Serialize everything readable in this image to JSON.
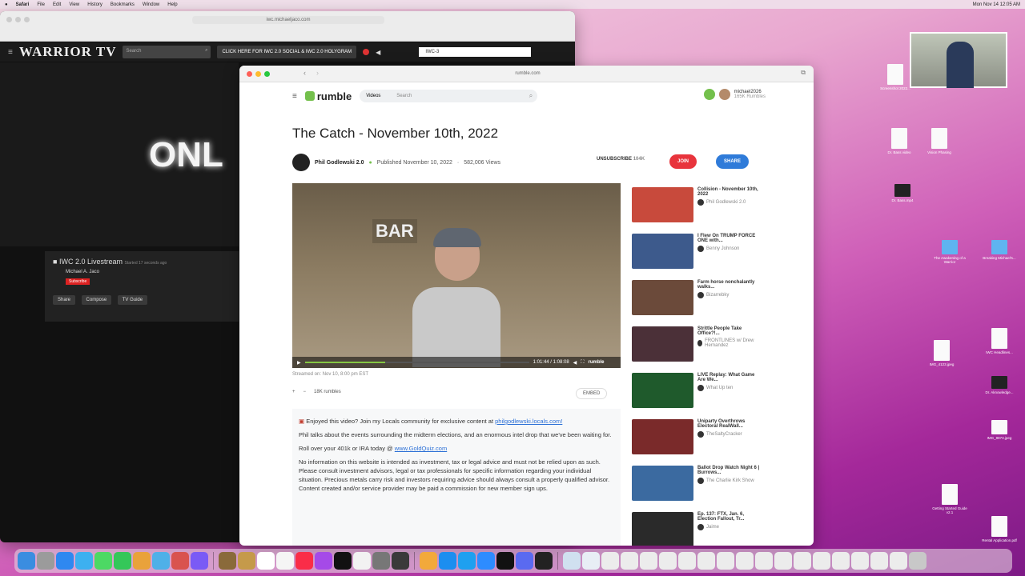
{
  "menubar": {
    "app": "Safari",
    "items": [
      "File",
      "Edit",
      "View",
      "History",
      "Bookmarks",
      "Window",
      "Help"
    ],
    "clock": "Mon Nov 14 12:05 AM"
  },
  "bg": {
    "url": "iwc.michaeljaco.com",
    "logo": "WARRIOR TV",
    "search_placeholder": "Search",
    "cta": "CLICK HERE FOR IWC 2.0 SOCIAL & IWC 2.0 HOLYGRAM",
    "channel_tab": "IWC-3",
    "video_text": "ONL",
    "stream_title": "IWC 2.0 Livestream",
    "stream_time": "Started 17 seconds ago",
    "stream_author": "Michael A. Jaco",
    "subscribe": "Subscribe",
    "actions": [
      "Share",
      "Compose",
      "TV Guide"
    ]
  },
  "rumble": {
    "url": "rumble.com",
    "logo": "rumble",
    "videos": "Videos",
    "search_placeholder": "Search",
    "user": "michael2026",
    "user_sub": "165K Rumbles",
    "title": "The Catch - November 10th, 2022",
    "channel": "Phil Godlewski 2.0",
    "published": "Published November 10, 2022",
    "views": "582,006 Views",
    "unsubscribe": "UNSUBSCRIBE",
    "sub_count": "104K",
    "join": "JOIN",
    "share": "SHARE",
    "player": {
      "sign": "BAR",
      "time": "1:01:44 / 1:08:08",
      "brand": "rumble"
    },
    "streamed": "Streamed on: Nov 10, 8:00 pm EST",
    "rumbles": "18K rumbles",
    "embed": "EMBED",
    "desc": {
      "line1": "Enjoyed this video? Join my Locals community for exclusive content at ",
      "link1": "philgodlewski.locals.com!",
      "line2": "Phil talks about the events surrounding the midterm elections, and an enormous intel drop that we've been waiting for.",
      "line3": "Roll over your 401k or IRA today @ ",
      "link3": "www.GoldQuiz.com",
      "line4": "No information on this website is intended as investment, tax or legal advice and must not be relied upon as such. Please consult investment advisors, legal or tax professionals for specific information regarding your individual situation. Precious metals carry risk and investors requiring advice should always consult a properly qualified advisor. Content created and/or service provider may be paid a commission for new member sign ups."
    },
    "sidebar": [
      {
        "title": "Collision - November 10th, 2022",
        "channel": "Phil Godlewski 2.0",
        "color": "#c84a3c"
      },
      {
        "title": "I Flew On TRUMP FORCE ONE with...",
        "channel": "Benny Johnson",
        "color": "#3d5a8c"
      },
      {
        "title": "Farm horse nonchalantly walks...",
        "channel": "Bizarrebky",
        "color": "#6b4a3a"
      },
      {
        "title": "Strittle People Take Office?!...",
        "channel": "FRONTLINES w/ Drew Hernandez",
        "color": "#4b3038"
      },
      {
        "title": "LIVE Replay: What Game Are We...",
        "channel": "What Up ten",
        "color": "#1f5a2c"
      },
      {
        "title": "Uniparty Overthrows Electoral RealWall...",
        "channel": "TheSaltyCracker",
        "color": "#7a2a2a"
      },
      {
        "title": "Ballot Drop Watch Night 6 | Burrows...",
        "channel": "The Charlie Kirk Show",
        "color": "#3b6aa0"
      },
      {
        "title": "Ep. 137: FTX, Jan. 6, Election Fallout, Tr...",
        "channel": "Jaime",
        "color": "#2a2a2a"
      }
    ]
  },
  "desktop": [
    "Screenshot 2022...",
    "Dr. Bass video",
    "Vision Phasing",
    "Dr. Bass.mp4",
    "The Awakening of a Warrior",
    "Breaking Michael's...",
    "IMG_4123.jpeg",
    "IWC Headlines...",
    "IMG_8873.jpeg",
    "Dr. Aknowledge...",
    "Getting Started Guide v2.1",
    "Rental Application.pdf"
  ]
}
